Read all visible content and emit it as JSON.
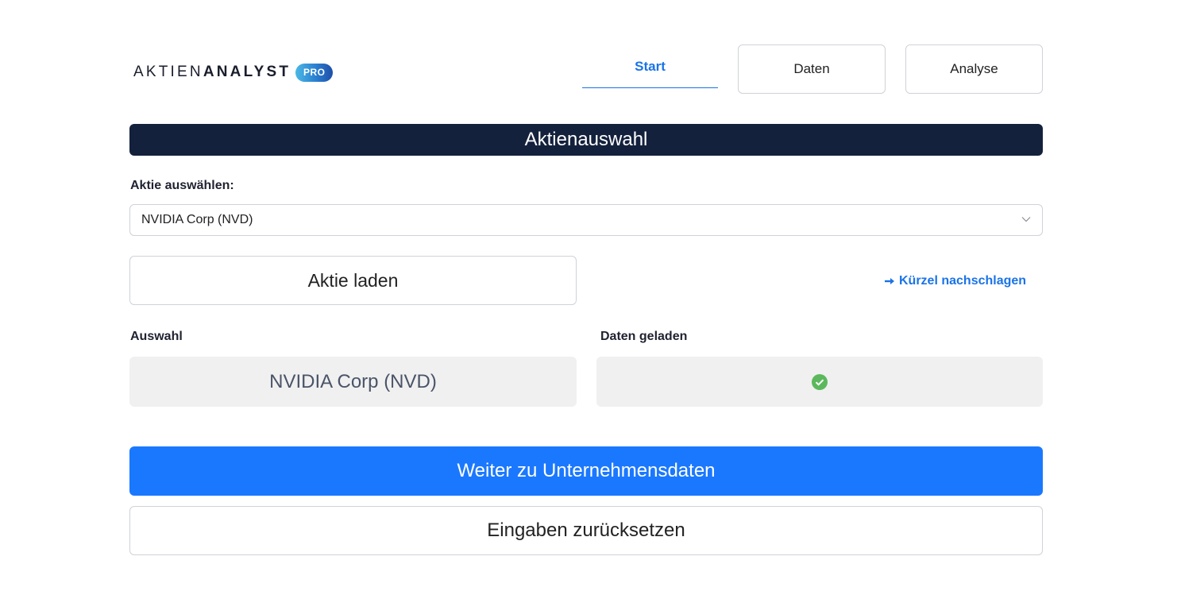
{
  "header": {
    "logo_light": "AKTIEN",
    "logo_bold": "ANALYST",
    "logo_badge": "PRO",
    "tabs": [
      {
        "label": "Start",
        "active": true
      },
      {
        "label": "Daten",
        "active": false
      },
      {
        "label": "Analyse",
        "active": false
      }
    ]
  },
  "section": {
    "title": "Aktienauswahl"
  },
  "form": {
    "select_label": "Aktie auswählen:",
    "select_value": "NVIDIA Corp (NVD)",
    "load_button": "Aktie laden",
    "lookup_link": "Kürzel nachschlagen",
    "lookup_icon": "arrow-right-icon"
  },
  "status": {
    "selection_label": "Auswahl",
    "selection_value": "NVIDIA Corp (NVD)",
    "loaded_label": "Daten geladen",
    "loaded_icon": "check-circle-icon",
    "loaded_color": "#5cb85c"
  },
  "actions": {
    "next_button": "Weiter zu Unternehmensdaten",
    "reset_button": "Eingaben zurücksetzen"
  },
  "colors": {
    "accent": "#1a78ff",
    "header_bg": "#14213d"
  }
}
